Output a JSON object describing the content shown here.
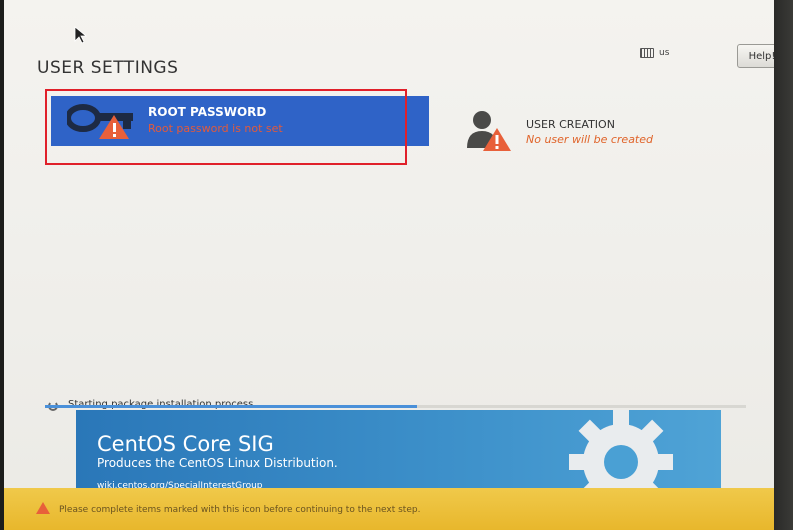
{
  "header": {
    "title": "USER SETTINGS",
    "keyboard_layout": "us",
    "help_label": "Help!"
  },
  "spokes": {
    "root": {
      "name": "ROOT PASSWORD",
      "status": "Root password is not set"
    },
    "user": {
      "name": "USER CREATION",
      "status": "No user will be created"
    }
  },
  "progress": {
    "text": "Starting package installation process",
    "fraction": 0.53
  },
  "banner": {
    "heading": "CentOS Core SIG",
    "subheading": "Produces the CentOS Linux Distribution.",
    "link": "wiki.centos.org/SpecialInterestGroup"
  },
  "warning": {
    "text": "Please complete items marked with this icon before continuing to the next step."
  },
  "colors": {
    "spoke_selected": "#2f63c7",
    "warning_orange": "#e0642a",
    "warnbar": "#e8b72c",
    "highlight_box": "#e0202a"
  }
}
